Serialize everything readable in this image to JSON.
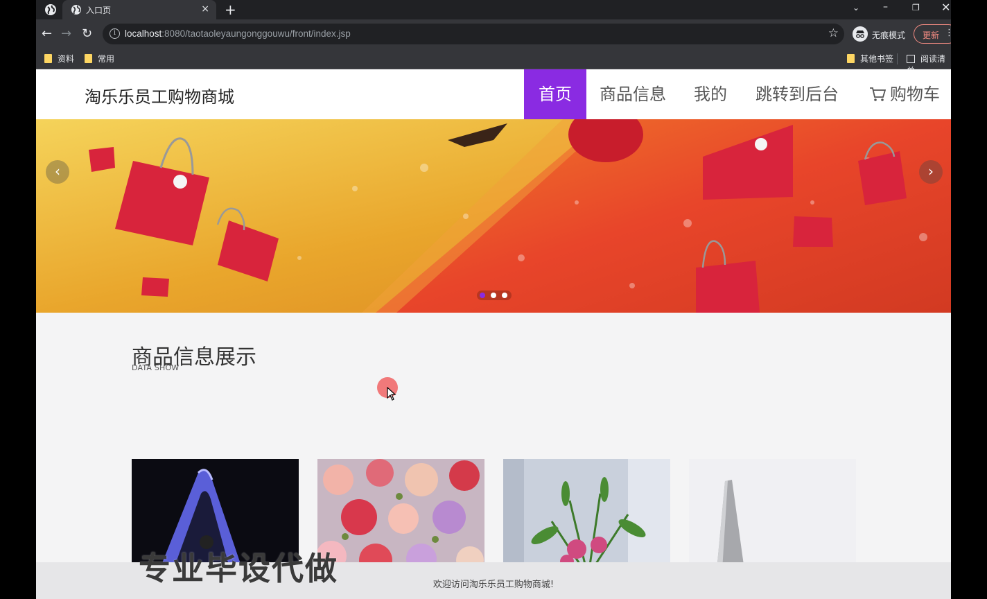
{
  "browser": {
    "tab_title": "入口页",
    "tab_close": "×",
    "new_tab": "+",
    "url_host": "localhost",
    "url_rest": ":8080/taotaoleyaungonggouwu/front/index.jsp",
    "incognito_label": "无痕模式",
    "update_label": "更新",
    "bookmarks": [
      "资料",
      "常用"
    ],
    "other_bookmarks": "其他书签",
    "reading_list": "阅读清单"
  },
  "site": {
    "title": "淘乐乐员工购物商城",
    "nav": [
      "首页",
      "商品信息",
      "我的",
      "跳转到后台",
      "购物车"
    ],
    "active_nav": "首页",
    "accent_color": "#8a2be2"
  },
  "banner": {
    "slide_count": 3,
    "active_slide": 1
  },
  "section": {
    "title": "商品信息展示",
    "subtitle": "DATA SHOW"
  },
  "products": [
    {
      "image": "dark-phone-curve"
    },
    {
      "image": "roses-bouquet"
    },
    {
      "image": "lilies-bouquet"
    },
    {
      "image": "white-laptop"
    }
  ],
  "overlay_watermark": "专业毕设代做",
  "footer": {
    "text": "欢迎访问淘乐乐员工购物商城!"
  }
}
